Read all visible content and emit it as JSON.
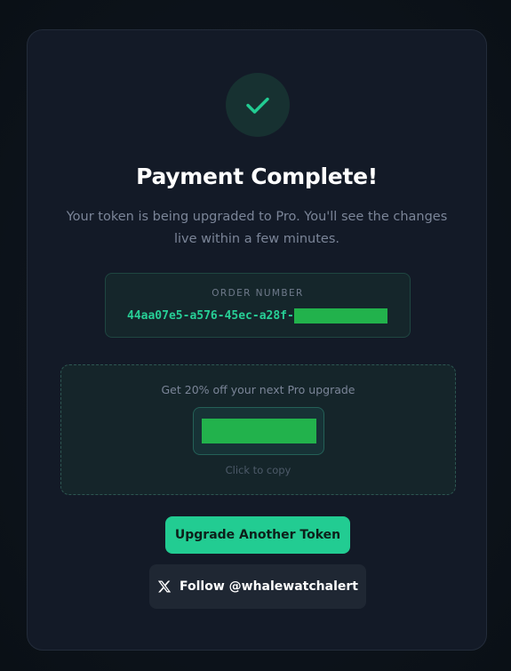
{
  "success": {
    "title": "Payment Complete!",
    "message": "Your token is being upgraded to Pro. You'll see the changes live within a few minutes."
  },
  "order": {
    "label": "ORDER NUMBER",
    "value_visible": "44aa07e5-a576-45ec-a28f-"
  },
  "promo": {
    "heading": "Get 20% off your next Pro upgrade",
    "hint": "Click to copy"
  },
  "actions": {
    "primary_label": "Upgrade Another Token",
    "follow_label": "Follow @whalewatchalert"
  },
  "colors": {
    "accent": "#22cc92",
    "card_bg": "#131a27",
    "redaction": "#22b24c"
  },
  "icons": {
    "success": "checkmark-icon",
    "social": "x-logo-icon"
  }
}
